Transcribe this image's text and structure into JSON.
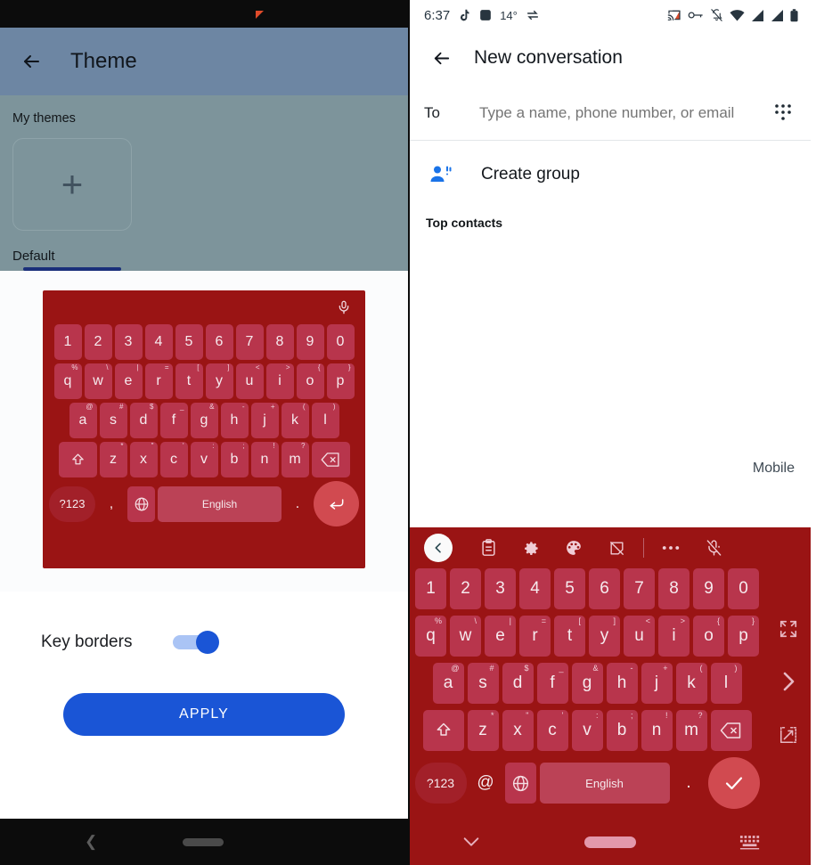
{
  "left_phone": {
    "statusbar": {
      "notification_icon": "red-triangle-notification"
    },
    "appbar": {
      "back_icon": "arrow-left-icon",
      "title": "Theme"
    },
    "themes": {
      "section_label": "My themes",
      "add_icon": "plus-icon",
      "selected_theme_label": "Default"
    },
    "settings": {
      "key_borders_label": "Key borders",
      "key_borders_on": true,
      "apply_label": "APPLY"
    },
    "navbar": {
      "back_icon": "chevron-left-icon",
      "home_pill": "home-pill"
    },
    "keyboard_preview": {
      "mic_icon": "microphone-icon",
      "rows": {
        "numbers": [
          {
            "main": "1"
          },
          {
            "main": "2"
          },
          {
            "main": "3"
          },
          {
            "main": "4"
          },
          {
            "main": "5"
          },
          {
            "main": "6"
          },
          {
            "main": "7"
          },
          {
            "main": "8"
          },
          {
            "main": "9"
          },
          {
            "main": "0"
          }
        ],
        "top": [
          {
            "main": "q",
            "sub": "%"
          },
          {
            "main": "w",
            "sub": "\\"
          },
          {
            "main": "e",
            "sub": "|"
          },
          {
            "main": "r",
            "sub": "="
          },
          {
            "main": "t",
            "sub": "["
          },
          {
            "main": "y",
            "sub": "]"
          },
          {
            "main": "u",
            "sub": "<"
          },
          {
            "main": "i",
            "sub": ">"
          },
          {
            "main": "o",
            "sub": "{"
          },
          {
            "main": "p",
            "sub": "}"
          }
        ],
        "home": [
          {
            "main": "a",
            "sub": "@"
          },
          {
            "main": "s",
            "sub": "#"
          },
          {
            "main": "d",
            "sub": "$"
          },
          {
            "main": "f",
            "sub": "_"
          },
          {
            "main": "g",
            "sub": "&"
          },
          {
            "main": "h",
            "sub": "-"
          },
          {
            "main": "j",
            "sub": "+"
          },
          {
            "main": "k",
            "sub": "("
          },
          {
            "main": "l",
            "sub": ")"
          }
        ],
        "bottom": [
          {
            "main": "z",
            "sub": "*"
          },
          {
            "main": "x",
            "sub": "\""
          },
          {
            "main": "c",
            "sub": "'"
          },
          {
            "main": "v",
            "sub": ":"
          },
          {
            "main": "b",
            "sub": ";"
          },
          {
            "main": "n",
            "sub": "!"
          },
          {
            "main": "m",
            "sub": "?"
          }
        ],
        "shift_icon": "shift-icon",
        "delete_icon": "backspace-icon",
        "space_row": {
          "symbols_label": "?123",
          "comma": ",",
          "globe_icon": "globe-icon",
          "space_label": "English",
          "period": ".",
          "enter_icon": "enter-icon"
        }
      }
    }
  },
  "right_phone": {
    "statusbar": {
      "time": "6:37",
      "temperature": "14°",
      "left_icons": [
        "tiktok-icon",
        "square-app-icon",
        "sync-swap-icon"
      ],
      "right_icons": [
        "cast-icon",
        "vpn-key-icon",
        "notifications-off-icon",
        "wifi-icon",
        "signal-icon",
        "signal-icon-2",
        "battery-icon"
      ]
    },
    "appbar": {
      "back_icon": "arrow-left-icon",
      "title": "New conversation"
    },
    "recipient": {
      "to_label": "To",
      "input_value": "",
      "input_placeholder": "Type a name, phone number, or email",
      "dialpad_icon": "dialpad-icon"
    },
    "create_group": {
      "icon": "group-add-icon",
      "label": "Create group"
    },
    "contacts": {
      "section_label": "Top contacts",
      "items": []
    },
    "mobile_label": "Mobile",
    "keyboard": {
      "toolbar": [
        {
          "icon": "chevron-left-icon",
          "highlighted": true
        },
        {
          "icon": "clipboard-icon"
        },
        {
          "icon": "gear-icon"
        },
        {
          "icon": "palette-icon"
        },
        {
          "icon": "sticker-off-icon"
        },
        {
          "icon": "more-horizontal-icon"
        },
        {
          "icon": "microphone-off-icon"
        }
      ],
      "side_icons": [
        "fullscreen-expand-icon",
        "chevron-right-icon",
        "floating-window-icon"
      ],
      "rows": {
        "numbers": [
          {
            "main": "1"
          },
          {
            "main": "2"
          },
          {
            "main": "3"
          },
          {
            "main": "4"
          },
          {
            "main": "5"
          },
          {
            "main": "6"
          },
          {
            "main": "7"
          },
          {
            "main": "8"
          },
          {
            "main": "9"
          },
          {
            "main": "0"
          }
        ],
        "top": [
          {
            "main": "q",
            "sub": "%"
          },
          {
            "main": "w",
            "sub": "\\"
          },
          {
            "main": "e",
            "sub": "|"
          },
          {
            "main": "r",
            "sub": "="
          },
          {
            "main": "t",
            "sub": "["
          },
          {
            "main": "y",
            "sub": "]"
          },
          {
            "main": "u",
            "sub": "<"
          },
          {
            "main": "i",
            "sub": ">"
          },
          {
            "main": "o",
            "sub": "{"
          },
          {
            "main": "p",
            "sub": "}"
          }
        ],
        "home": [
          {
            "main": "a",
            "sub": "@"
          },
          {
            "main": "s",
            "sub": "#"
          },
          {
            "main": "d",
            "sub": "$"
          },
          {
            "main": "f",
            "sub": "_"
          },
          {
            "main": "g",
            "sub": "&"
          },
          {
            "main": "h",
            "sub": "-"
          },
          {
            "main": "j",
            "sub": "+"
          },
          {
            "main": "k",
            "sub": "("
          },
          {
            "main": "l",
            "sub": ")"
          }
        ],
        "bottom": [
          {
            "main": "z",
            "sub": "*"
          },
          {
            "main": "x",
            "sub": "\""
          },
          {
            "main": "c",
            "sub": "'"
          },
          {
            "main": "v",
            "sub": ":"
          },
          {
            "main": "b",
            "sub": ";"
          },
          {
            "main": "n",
            "sub": "!"
          },
          {
            "main": "m",
            "sub": "?"
          }
        ],
        "shift_icon": "shift-icon",
        "delete_icon": "backspace-icon",
        "space_row": {
          "symbols_label": "?123",
          "at": "@",
          "globe_icon": "globe-icon",
          "space_label": "English",
          "period": ".",
          "enter_icon": "check-icon"
        }
      },
      "navbar": {
        "down_icon": "chevron-down-icon",
        "home_pill": "home-pill",
        "keyboard_icon": "keyboard-icon"
      }
    }
  },
  "colors": {
    "keyboard_bg": "#9a1414",
    "key_bg": "#b8354c",
    "accent_blue": "#1a55d6",
    "theme_header": "#6d86a3",
    "theme_body": "#7d949b"
  }
}
